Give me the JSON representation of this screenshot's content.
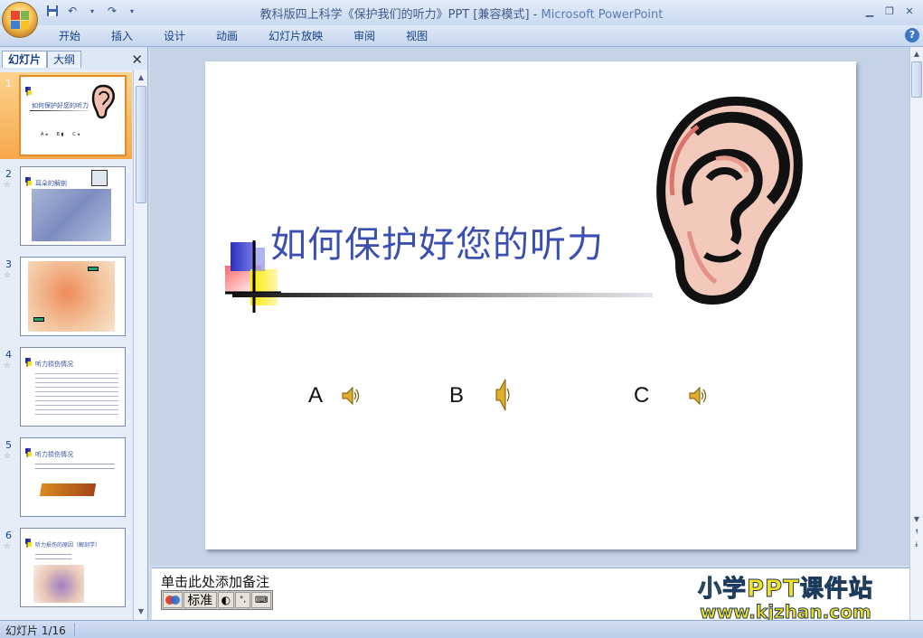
{
  "window": {
    "title": "教科版四上科学《保护我们的听力》PPT [兼容模式]",
    "separator": " - ",
    "app_name": "Microsoft PowerPoint"
  },
  "ribbon": {
    "tabs": [
      "开始",
      "插入",
      "设计",
      "动画",
      "幻灯片放映",
      "审阅",
      "视图"
    ]
  },
  "left_panel": {
    "tabs": [
      "幻灯片",
      "大纲"
    ],
    "slides": [
      {
        "number": "1",
        "title": "如何保护好您的听力",
        "selected": true
      },
      {
        "number": "2",
        "title": "耳朵的解剖",
        "selected": false
      },
      {
        "number": "3",
        "title": "",
        "selected": false
      },
      {
        "number": "4",
        "title": "听力损伤情况",
        "selected": false
      },
      {
        "number": "5",
        "title": "听力损伤情况",
        "selected": false
      },
      {
        "number": "6",
        "title": "听力损伤的原因（解剖学）",
        "selected": false
      }
    ]
  },
  "slide": {
    "title": "如何保护好您的听力",
    "options": [
      "A",
      "B",
      "C"
    ]
  },
  "notes": {
    "placeholder": "单击此处添加备注",
    "ime_mode": "标准"
  },
  "watermark": {
    "line1": "小学PPT课件站",
    "line2": "www.kjzhan.com"
  },
  "status_bar": {
    "slide_counter": "幻灯片 1/16"
  },
  "colors": {
    "slide_title": "#3a4fb0",
    "selected_thumb": "#f7a84b",
    "watermark": "#f5e020"
  }
}
